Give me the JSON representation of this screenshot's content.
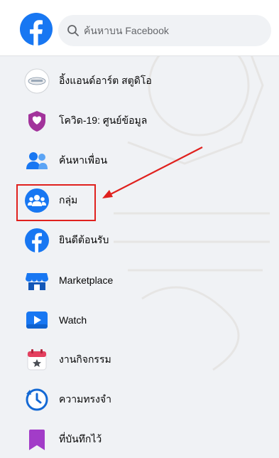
{
  "header": {
    "search_placeholder": "ค้นหาบน Facebook",
    "brand_color": "#1877f2"
  },
  "menu": {
    "items": [
      {
        "label": "อิ้งแอนด์อาร์ต สตูดิโอ",
        "icon": "page-avatar-icon"
      },
      {
        "label": "โควิด-19: ศูนย์ข้อมูล",
        "icon": "covid-shield-icon"
      },
      {
        "label": "ค้นหาเพื่อน",
        "icon": "friends-icon"
      },
      {
        "label": "กลุ่ม",
        "icon": "groups-icon"
      },
      {
        "label": "ยินดีต้อนรับ",
        "icon": "facebook-welcome-icon"
      },
      {
        "label": "Marketplace",
        "icon": "marketplace-icon"
      },
      {
        "label": "Watch",
        "icon": "watch-icon"
      },
      {
        "label": "งานกิจกรรม",
        "icon": "events-icon"
      },
      {
        "label": "ความทรงจำ",
        "icon": "memories-icon"
      },
      {
        "label": "ที่บันทึกไว้",
        "icon": "saved-icon"
      }
    ]
  },
  "annotation": {
    "highlight_color": "#e0211e"
  }
}
